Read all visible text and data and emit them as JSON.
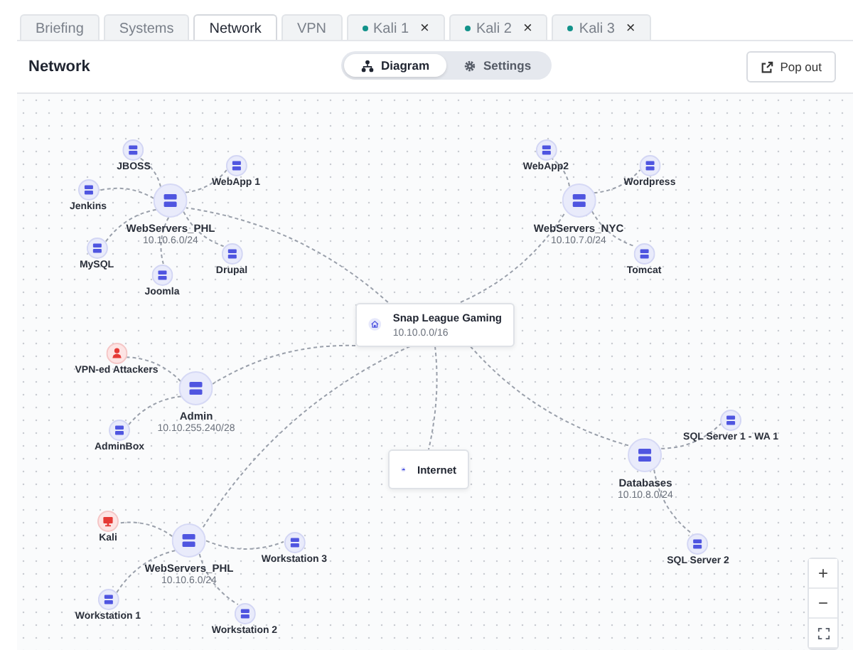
{
  "tabs": [
    {
      "label": "Briefing",
      "kind": "page",
      "selected": false
    },
    {
      "label": "Systems",
      "kind": "page",
      "selected": false
    },
    {
      "label": "Network",
      "kind": "page",
      "selected": true
    },
    {
      "label": "VPN",
      "kind": "page",
      "selected": false
    },
    {
      "label": "Kali 1",
      "kind": "session",
      "selected": false,
      "close": "×"
    },
    {
      "label": "Kali 2",
      "kind": "session",
      "selected": false,
      "close": "×"
    },
    {
      "label": "Kali 3",
      "kind": "session",
      "selected": false,
      "close": "×"
    }
  ],
  "header": {
    "title": "Network",
    "views": [
      {
        "label": "Diagram",
        "kind": "diagram",
        "selected": true
      },
      {
        "label": "Settings",
        "kind": "settings",
        "selected": false
      }
    ],
    "popout": "Pop out"
  },
  "diagram": {
    "hub": {
      "name": "Snap League Gaming",
      "cidr": "10.10.0.0/16"
    },
    "subnets": [
      {
        "name": "WebServers_PHL",
        "cidr": "10.10.6.0/24",
        "hosts": [
          {
            "name": "JBOSS",
            "kind": "server"
          },
          {
            "name": "WebApp 1",
            "kind": "server"
          },
          {
            "name": "Jenkins",
            "kind": "server"
          },
          {
            "name": "MySQL",
            "kind": "server"
          },
          {
            "name": "Joomla",
            "kind": "server"
          },
          {
            "name": "Drupal",
            "kind": "server"
          }
        ]
      },
      {
        "name": "WebServers_NYC",
        "cidr": "10.10.7.0/24",
        "hosts": [
          {
            "name": "WebApp2",
            "kind": "server"
          },
          {
            "name": "Wordpress",
            "kind": "server"
          },
          {
            "name": "Tomcat",
            "kind": "server"
          }
        ]
      },
      {
        "name": "Admin",
        "cidr": "10.10.255.240/28",
        "hosts": [
          {
            "name": "VPN-ed Attackers",
            "kind": "attacker-user"
          },
          {
            "name": "AdminBox",
            "kind": "server"
          }
        ]
      },
      {
        "name": "WebServers_PHL",
        "cidr": "10.10.6.0/24",
        "hosts": [
          {
            "name": "Kali",
            "kind": "attacker-machine"
          },
          {
            "name": "Workstation 3",
            "kind": "server"
          },
          {
            "name": "Workstation 1",
            "kind": "server"
          },
          {
            "name": "Workstation 2",
            "kind": "server"
          }
        ]
      },
      {
        "name": "Databases",
        "cidr": "10.10.8.0/24",
        "hosts": [
          {
            "name": "SQL Server 1 - WA 1",
            "kind": "server"
          },
          {
            "name": "SQL Server 2",
            "kind": "server"
          }
        ]
      }
    ],
    "internet": {
      "label": "Internet"
    },
    "zoom_controls": [
      "+",
      "−"
    ]
  }
}
